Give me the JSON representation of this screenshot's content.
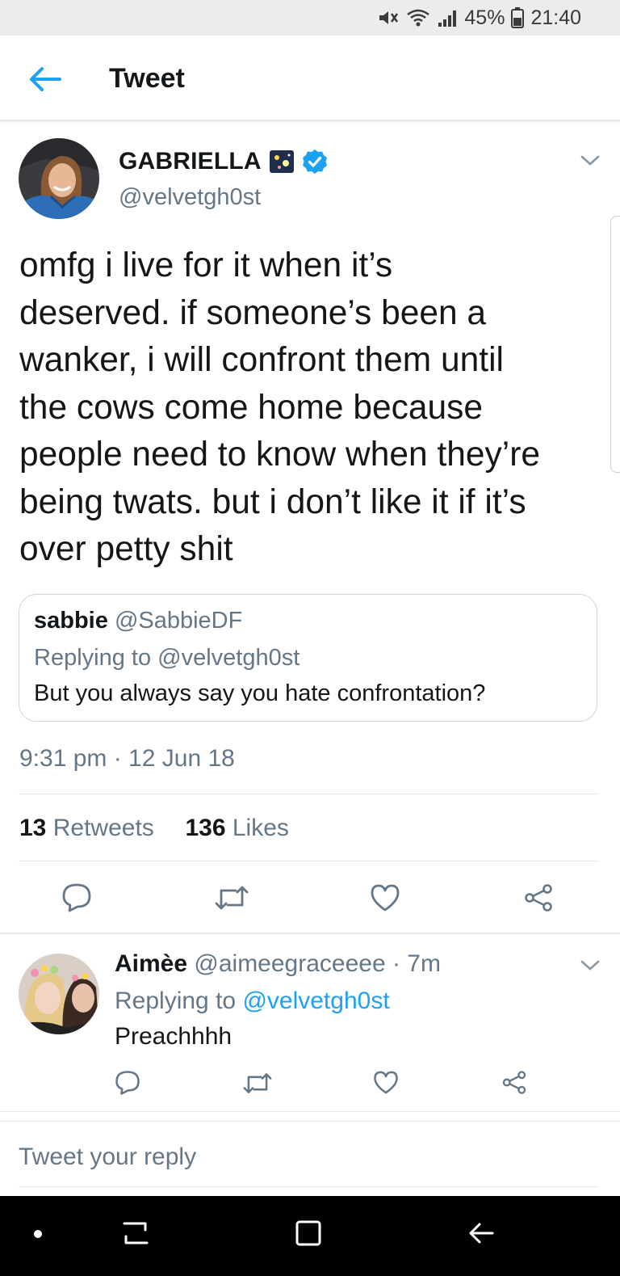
{
  "status_bar": {
    "battery": "45%",
    "time": "21:40",
    "icons": [
      "mute-icon",
      "wifi-icon",
      "signal-icon",
      "battery-icon"
    ]
  },
  "app_bar": {
    "title": "Tweet",
    "back_icon": "arrow-left-icon"
  },
  "tweet": {
    "display_name": "GABRIELLA",
    "handle": "@velvetgh0st",
    "text_lines": [
      "omfg i live for it when it’s",
      "deserved. if someone’s been a",
      "wanker, i will confront them until",
      "the cows come home because",
      "people need to know when they’re",
      "being twats. but i don’t like it if it’s",
      "over petty shit"
    ],
    "quoted": {
      "name": "sabbie",
      "handle": "@SabbieDF",
      "replying": "Replying to @velvetgh0st",
      "text": "But you always say you hate confrontation?"
    },
    "timestamp": "9:31 pm · 12 Jun 18",
    "retweets_count": "13",
    "retweets_label": "Retweets",
    "likes_count": "136",
    "likes_label": "Likes"
  },
  "reply": {
    "name": "Aimèe",
    "meta": "@aimeegraceeee · 7m",
    "replying_prefix": "Replying to",
    "replying_mention": "@velvetgh0st",
    "text": "Preachhhh"
  },
  "compose": {
    "placeholder": "Tweet your reply"
  },
  "colors": {
    "accent": "#1da1f2",
    "secondary_text": "#657786",
    "border": "#e1e8ed"
  }
}
